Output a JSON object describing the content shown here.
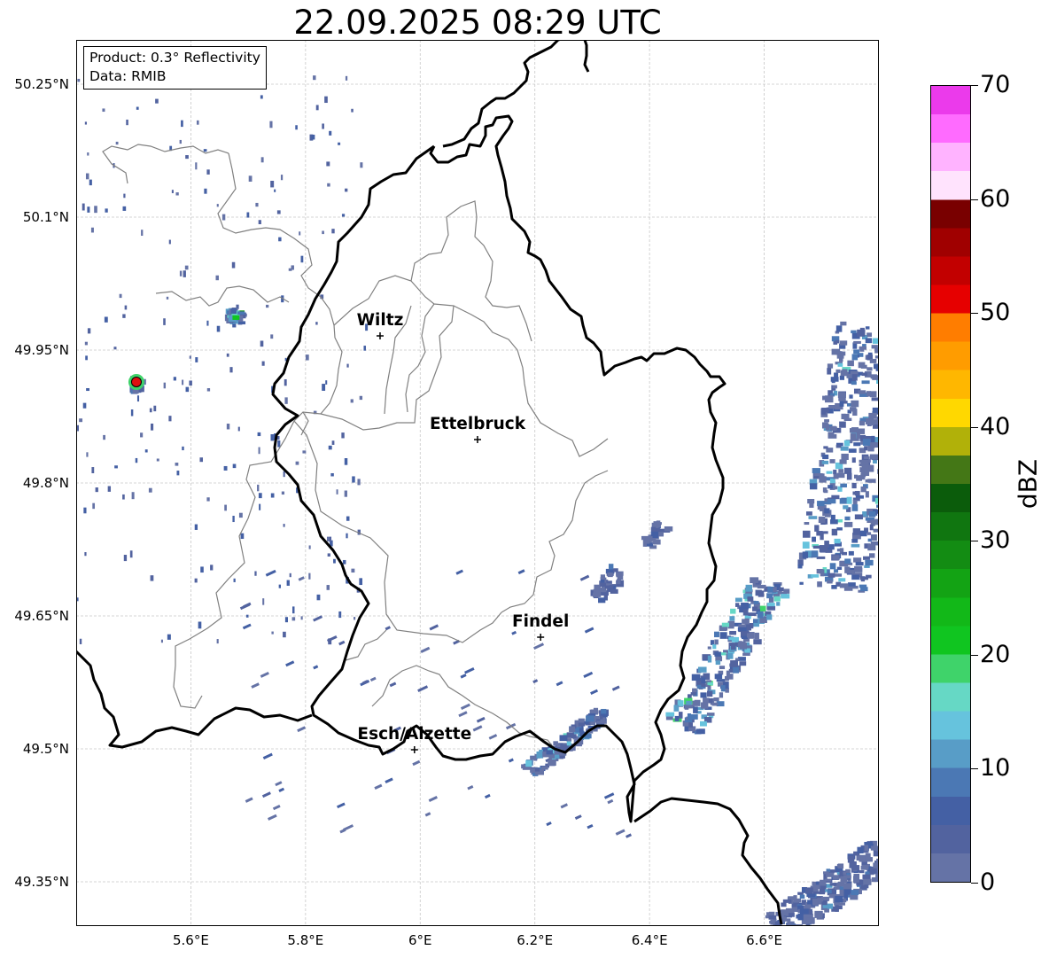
{
  "title": "22.09.2025 08:29 UTC",
  "info_box": {
    "product": "Product: 0.3° Reflectivity",
    "data_source": "Data: RMIB"
  },
  "map": {
    "extent": {
      "lon_min": 5.4,
      "lon_max": 6.8,
      "lat_min": 49.3,
      "lat_max": 50.3
    },
    "lat_ticks": [
      {
        "value": 50.25,
        "label": "50.25°N"
      },
      {
        "value": 50.1,
        "label": "50.1°N"
      },
      {
        "value": 49.95,
        "label": "49.95°N"
      },
      {
        "value": 49.8,
        "label": "49.8°N"
      },
      {
        "value": 49.65,
        "label": "49.65°N"
      },
      {
        "value": 49.5,
        "label": "49.5°N"
      },
      {
        "value": 49.35,
        "label": "49.35°N"
      }
    ],
    "lon_ticks": [
      {
        "value": 5.6,
        "label": "5.6°E"
      },
      {
        "value": 5.8,
        "label": "5.8°E"
      },
      {
        "value": 6.0,
        "label": "6°E"
      },
      {
        "value": 6.2,
        "label": "6.2°E"
      },
      {
        "value": 6.4,
        "label": "6.4°E"
      },
      {
        "value": 6.6,
        "label": "6.6°E"
      }
    ],
    "grid": true,
    "cities": [
      {
        "name": "Wiltz",
        "lon": 5.93,
        "lat": 49.966
      },
      {
        "name": "Ettelbruck",
        "lon": 6.1,
        "lat": 49.849
      },
      {
        "name": "Findel",
        "lon": 6.21,
        "lat": 49.626
      },
      {
        "name": "Esch/Alzette",
        "lon": 5.99,
        "lat": 49.499
      }
    ],
    "radar_site": {
      "lon": 5.505,
      "lat": 49.914,
      "color": "#e01010"
    },
    "border_color": "#000000",
    "canton_color": "#808080"
  },
  "colorbar": {
    "label": "dBZ",
    "min": 0,
    "max": 70,
    "ticks": [
      0,
      10,
      20,
      30,
      40,
      50,
      60,
      70
    ],
    "colors": [
      "#6573a6",
      "#52639f",
      "#4460a4",
      "#4b78b4",
      "#589dc7",
      "#66c3dd",
      "#66d8c5",
      "#3fd36a",
      "#10c520",
      "#12b818",
      "#13a314",
      "#138c13",
      "#107610",
      "#0b5c0b",
      "#447716",
      "#b1b109",
      "#ffd800",
      "#ffb700",
      "#ff9c00",
      "#ff7d00",
      "#e60000",
      "#c20000",
      "#a00000",
      "#790000",
      "#ffe3fd",
      "#ffb3ff",
      "#ff6bff",
      "#eb3aeb"
    ]
  }
}
